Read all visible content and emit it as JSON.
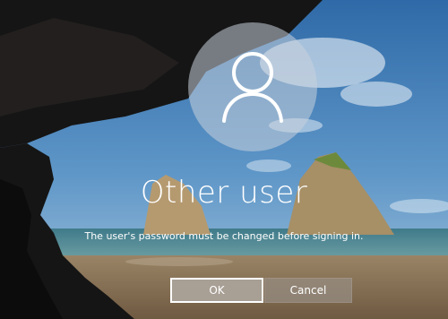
{
  "user": {
    "name": "Other user",
    "avatar_icon": "person-icon"
  },
  "message": "The user's password must be changed before signing in.",
  "buttons": {
    "ok_label": "OK",
    "cancel_label": "Cancel"
  },
  "colors": {
    "button_ok_bg": "#a89f95",
    "button_cancel_bg": "#968c82",
    "text": "#ffffff"
  }
}
